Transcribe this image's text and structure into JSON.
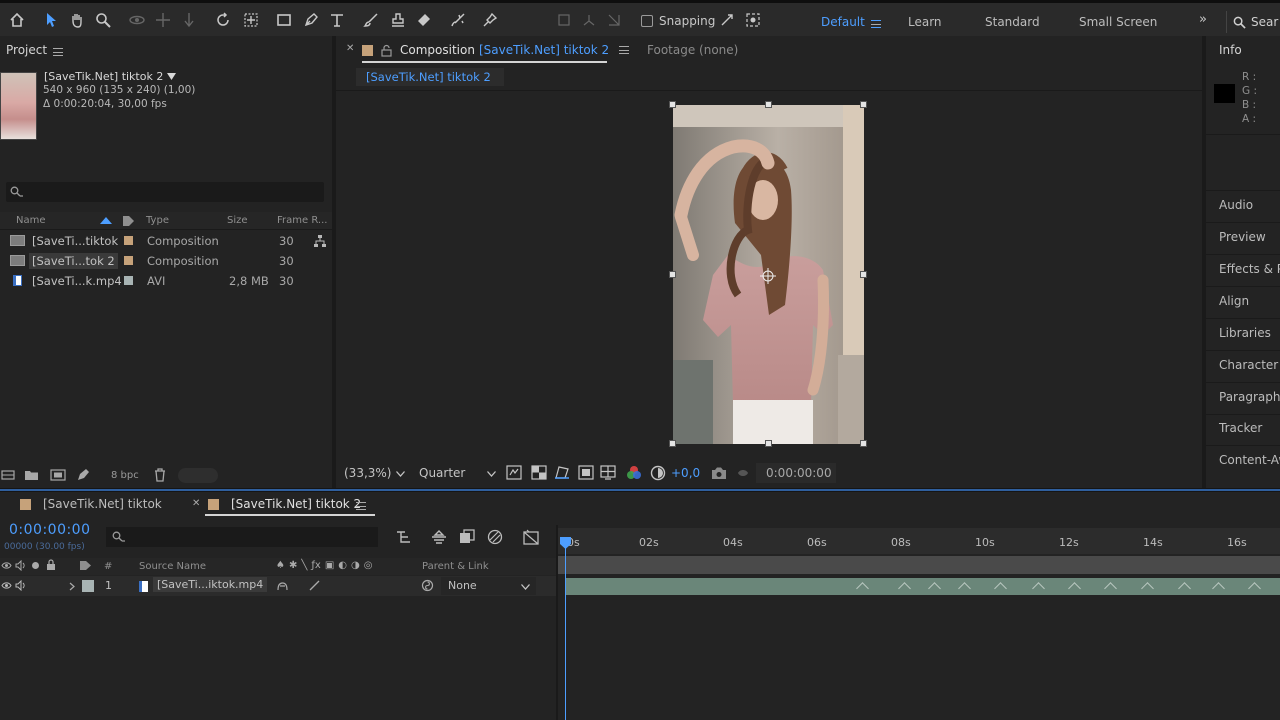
{
  "toolbar": {
    "snapping_label": "Snapping",
    "workspaces": [
      "Default",
      "Learn",
      "Standard",
      "Small Screen"
    ],
    "active_workspace": "Default",
    "search_label": "Sear",
    "accent_color": "#4d9eff"
  },
  "project": {
    "panel_title": "Project",
    "item_name": "[SaveTik.Net] tiktok 2",
    "item_dims": "540 x 960  (135 x 240) (1,00)",
    "item_duration": "Δ 0:00:20:04, 30,00 fps",
    "columns": {
      "name": "Name",
      "type": "Type",
      "size": "Size",
      "frame_rate": "Frame R..."
    },
    "rows": [
      {
        "name": "[SaveTi...tiktok",
        "type": "Composition",
        "size": "",
        "frame_rate": "30",
        "label_color": "#c6a27a",
        "kind": "comp"
      },
      {
        "name": "[SaveTi...tok 2",
        "type": "Composition",
        "size": "",
        "frame_rate": "30",
        "label_color": "#c6a27a",
        "kind": "comp",
        "selected": true
      },
      {
        "name": "[SaveTi...k.mp4",
        "type": "AVI",
        "size": "2,8 MB",
        "frame_rate": "30",
        "label_color": "#a8b4b4",
        "kind": "file"
      }
    ],
    "bpc": "8 bpc"
  },
  "composition": {
    "tab_prefix": "Composition",
    "tab_name": "[SaveTik.Net] tiktok 2",
    "footage_label": "Footage  (none)",
    "subtab": "[SaveTik.Net] tiktok 2",
    "zoom": "(33,3%)",
    "resolution": "Quarter",
    "exposure": "+0,0",
    "timecode": "0:00:00:00"
  },
  "info": {
    "panel_title": "Info",
    "channels": [
      "R :",
      "G :",
      "B :",
      "A :"
    ],
    "panels": [
      "Audio",
      "Preview",
      "Effects & Pr",
      "Align",
      "Libraries",
      "Character",
      "Paragraph",
      "Tracker",
      "Content-Aw"
    ]
  },
  "timeline": {
    "tabs": [
      "[SaveTik.Net] tiktok",
      "[SaveTik.Net] tiktok 2"
    ],
    "current_time": "0:00:00:00",
    "frame_info": "00000 (30.00 fps)",
    "ruler_labels": [
      "0s",
      "02s",
      "04s",
      "06s",
      "08s",
      "10s",
      "12s",
      "14s",
      "16s"
    ],
    "headers": {
      "num": "#",
      "source_name": "Source Name",
      "parent": "Parent & Link"
    },
    "layer": {
      "index": "1",
      "name": "[SaveTi...iktok.mp4",
      "parent": "None"
    }
  }
}
